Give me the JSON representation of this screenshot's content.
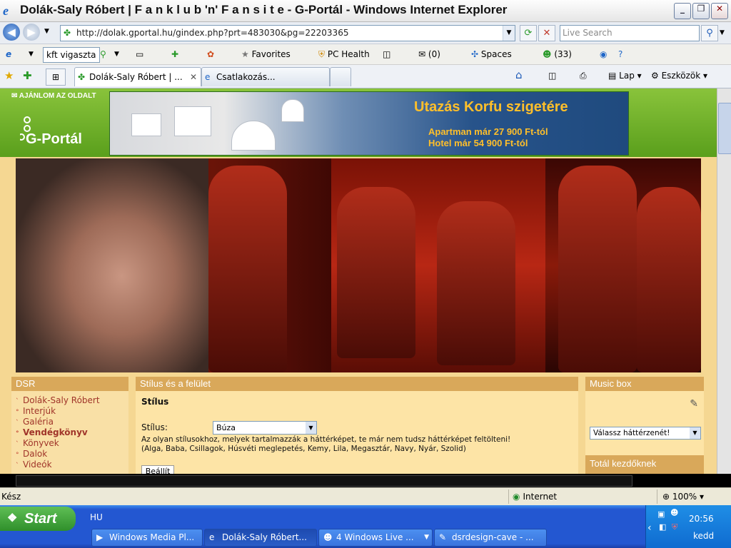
{
  "window": {
    "title": "Dolák-Saly Róbert | F a n k l u b 'n' F a n s i t e - G-Portál - Windows Internet Explorer",
    "minimize": "_",
    "maximize": "❐",
    "close": "✕"
  },
  "address": {
    "url": "http://dolak.gportal.hu/gindex.php?prt=483030&pg=22203365",
    "search_placeholder": "Live Search"
  },
  "links_toolbar": {
    "search_value": "kft vigaszta",
    "favorites": "Favorites",
    "pc_health": "PC Health",
    "mail_count": "(0)",
    "spaces": "Spaces",
    "messenger_count": "(33)"
  },
  "tabs": [
    {
      "label": "Dolák-Saly Róbert | ...",
      "active": true
    },
    {
      "label": "Csatlakozás...",
      "active": false
    }
  ],
  "tab_commands": {
    "page": "Lap",
    "tools": "Eszközök"
  },
  "page": {
    "recommend": "AJÁNLOM AZ OLDALT",
    "logo": "G-Portál",
    "banner": {
      "title": "Utazás Korfu szigetére",
      "line1": "Apartman már 27 900 Ft-tól",
      "line2": "Hotel már 54 900 Ft-tól"
    },
    "dsr_menu": {
      "header": "DSR",
      "items": [
        {
          "label": "Dolák-Saly Róbert",
          "bullet": "ˋ"
        },
        {
          "label": "Interjúk",
          "bullet": "°"
        },
        {
          "label": "Galéria",
          "bullet": "ˋ"
        },
        {
          "label": "Vendégkönyv",
          "bullet": "°",
          "bold": true
        },
        {
          "label": "Könyvek",
          "bullet": "ˋ"
        },
        {
          "label": "Dalok",
          "bullet": "°"
        },
        {
          "label": "Videók",
          "bullet": "ˋ"
        }
      ]
    },
    "style_panel": {
      "header": "Stílus és a felület",
      "heading": "Stílus",
      "label": "Stílus:",
      "selected": "Búza",
      "note1": "Az olyan stílusokhoz, melyek tartalmazzák a háttérképet, te már nem tudsz háttérképet feltölteni!",
      "note2": "(Alga, Baba, Csillagok, Húsvéti meglepetés, Kemy, Lila, Megasztár, Navy, Nyár, Szolid)",
      "button": "Beállít"
    },
    "music_box": {
      "header": "Music box",
      "select": "Válassz háttérzenét!"
    },
    "total": "Totál kezdőknek"
  },
  "status": {
    "text": "Kész",
    "zone": "Internet",
    "zoom": "100%"
  },
  "taskbar": {
    "start": "Start",
    "lang": "HU",
    "tasks": [
      {
        "label": "Windows Media Pl...",
        "icon": "media-player-icon"
      },
      {
        "label": "Dolák-Saly Róbert...",
        "icon": "ie-icon"
      },
      {
        "label": "4 Windows Live ...",
        "icon": "messenger-icon"
      },
      {
        "label": "dsrdesign-cave - ...",
        "icon": "paint-icon"
      }
    ],
    "clock": "20:56",
    "day": "kedd"
  },
  "colors": {
    "page_bg": "#f5d792",
    "box_header": "#d9a85a",
    "gportal_green": "#6aad28",
    "link_red": "#a0352a",
    "banner_text": "#ffbf2a"
  }
}
